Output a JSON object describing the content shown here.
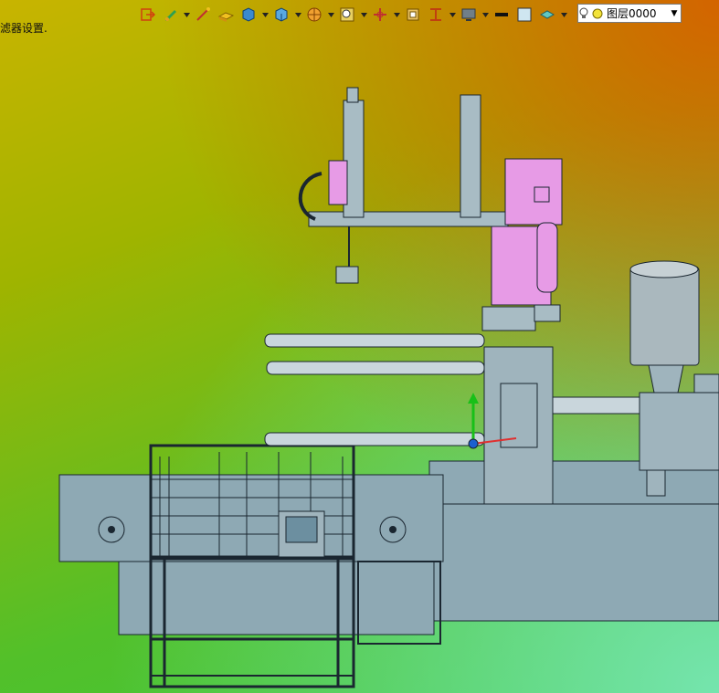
{
  "app": {
    "hint_text": "滤器设置."
  },
  "toolbar": {
    "tools": [
      {
        "name": "exit-sketch-icon",
        "dropdown": false
      },
      {
        "name": "sketch-pen-icon",
        "dropdown": true
      },
      {
        "name": "smart-dimension-icon",
        "dropdown": false
      },
      {
        "name": "extrude-boss-icon",
        "dropdown": false
      },
      {
        "name": "display-style-icon",
        "dropdown": true
      },
      {
        "name": "view-orientation-icon",
        "dropdown": true
      },
      {
        "name": "section-view-icon",
        "dropdown": true
      },
      {
        "name": "zoom-to-fit-icon",
        "dropdown": true
      },
      {
        "name": "rotate-view-icon",
        "dropdown": true
      },
      {
        "name": "previous-view-icon",
        "dropdown": false
      },
      {
        "name": "standard-views-icon",
        "dropdown": true
      },
      {
        "name": "monitor-icon",
        "dropdown": true
      },
      {
        "name": "line-style-icon",
        "dropdown": false
      },
      {
        "name": "color-box-icon",
        "dropdown": false
      },
      {
        "name": "layer-icon",
        "dropdown": true
      }
    ]
  },
  "layer_selector": {
    "value": "图层0000"
  },
  "colors": {
    "machine_body": "#8aa7b2",
    "pink_robot": "#e88ee8",
    "outline": "#1a2630",
    "axis_y": "#18c018",
    "axis_x": "#e03030"
  }
}
